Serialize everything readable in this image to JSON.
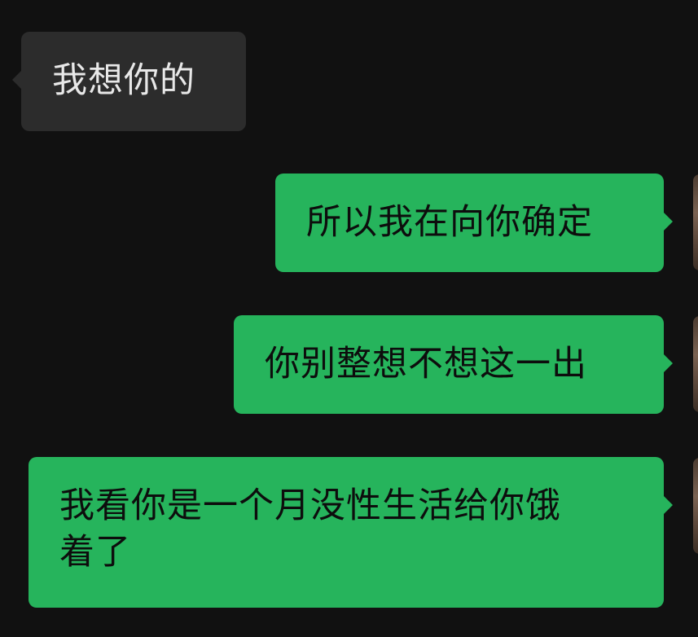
{
  "messages": [
    {
      "direction": "incoming",
      "text": "我想你的"
    },
    {
      "direction": "outgoing",
      "text": "所以我在向你确定"
    },
    {
      "direction": "outgoing",
      "text": "你别整想不想这一出"
    },
    {
      "direction": "outgoing",
      "text": "我看你是一个月没性生活给你饿\n着了"
    }
  ],
  "colors": {
    "background": "#111111",
    "incoming_bubble": "#2c2c2c",
    "outgoing_bubble": "#26b45c"
  },
  "icons": {
    "avatar": "user-avatar"
  }
}
